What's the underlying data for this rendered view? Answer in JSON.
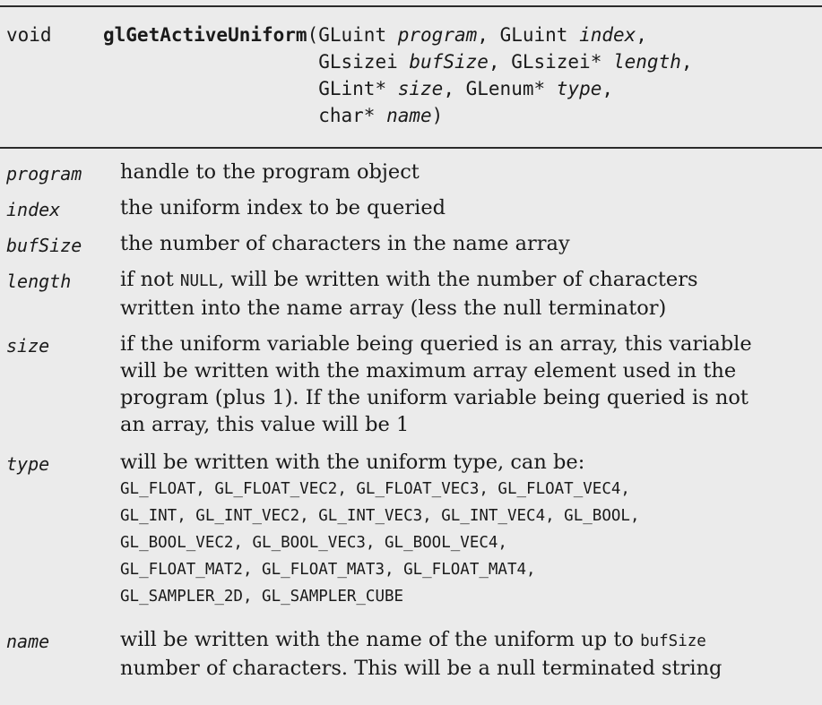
{
  "signature": {
    "return_type": "void",
    "function_name": "glGetActiveUniform",
    "open_paren": "(",
    "close_paren": ")",
    "params": [
      [
        {
          "type": "GLuint ",
          "name": "program",
          "sep": ", "
        },
        {
          "type": "GLuint ",
          "name": "index",
          "sep": ","
        }
      ],
      [
        {
          "type": "GLsizei ",
          "name": "bufSize",
          "sep": ", "
        },
        {
          "type": "GLsizei* ",
          "name": "length",
          "sep": ","
        }
      ],
      [
        {
          "type": "GLint* ",
          "name": "size",
          "sep": ", "
        },
        {
          "type": "GLenum* ",
          "name": "type",
          "sep": ","
        }
      ],
      [
        {
          "type": "char* ",
          "name": "name",
          "sep": ""
        }
      ]
    ]
  },
  "parameters": [
    {
      "name": "program",
      "lines": [
        "handle to the program object"
      ]
    },
    {
      "name": "index",
      "lines": [
        "the uniform index to be queried"
      ]
    },
    {
      "name": "bufSize",
      "lines": [
        "the number of characters in the name array"
      ]
    },
    {
      "name": "length",
      "line1_pre": "if not ",
      "line1_code": "NULL",
      "line1_post": ", will be written with the number of characters",
      "line2": "written into the name array (less the null terminator)"
    },
    {
      "name": "size",
      "lines": [
        "if the uniform variable being queried is an array, this variable",
        "will be written with the maximum array element used in the",
        "program (plus 1). If the uniform variable being queried is not",
        "an array, this value will be 1"
      ]
    },
    {
      "name": "type",
      "intro": "will be written with the uniform type, can be:",
      "enum_lines": [
        "GL_FLOAT, GL_FLOAT_VEC2, GL_FLOAT_VEC3, GL_FLOAT_VEC4,",
        "GL_INT, GL_INT_VEC2, GL_INT_VEC3, GL_INT_VEC4, GL_BOOL,",
        "GL_BOOL_VEC2, GL_BOOL_VEC3, GL_BOOL_VEC4,",
        "GL_FLOAT_MAT2, GL_FLOAT_MAT3, GL_FLOAT_MAT4,",
        "GL_SAMPLER_2D, GL_SAMPLER_CUBE"
      ]
    },
    {
      "name": "name",
      "line1_pre": "will be written with the name of the uniform up to ",
      "line1_code": "bufSize",
      "line2": "number of characters. This will be a null terminated string"
    }
  ]
}
